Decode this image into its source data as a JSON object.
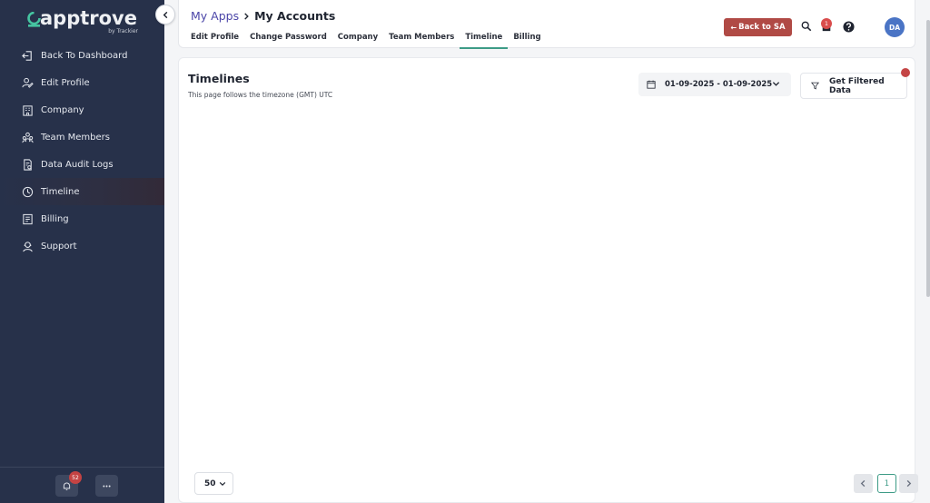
{
  "brand": {
    "name": "apptrove",
    "sub": "by Trackier"
  },
  "sidebar": {
    "items": [
      {
        "label": "Back To Dashboard",
        "icon": "back-dashboard-icon"
      },
      {
        "label": "Edit Profile",
        "icon": "user-edit-icon"
      },
      {
        "label": "Company",
        "icon": "building-icon"
      },
      {
        "label": "Team Members",
        "icon": "team-icon"
      },
      {
        "label": "Data Audit Logs",
        "icon": "audit-log-icon"
      },
      {
        "label": "Timeline",
        "icon": "timeline-icon",
        "active": true
      },
      {
        "label": "Billing",
        "icon": "billing-icon"
      },
      {
        "label": "Support",
        "icon": "support-icon"
      }
    ],
    "notification_count": "52"
  },
  "header": {
    "breadcrumb": {
      "parent": "My Apps",
      "current": "My Accounts"
    },
    "tabs": [
      {
        "label": "Edit Profile"
      },
      {
        "label": "Change Password"
      },
      {
        "label": "Company"
      },
      {
        "label": "Team Members"
      },
      {
        "label": "Timeline",
        "active": true
      },
      {
        "label": "Billing"
      }
    ],
    "back_button": "Back to SA",
    "cart_count": "1",
    "avatar_initials": "DA"
  },
  "main": {
    "title": "Timelines",
    "subtitle": "This page follows the timezone (GMT) UTC",
    "date_range": "01-09-2025 - 01-09-2025",
    "filter_button": "Get Filtered Data",
    "per_page": "50",
    "current_page": "1"
  },
  "colors": {
    "sidebar_bg": "#27314a",
    "accent": "#3d9b86",
    "danger": "#b04a45",
    "breadcrumb_link": "#4b45a8",
    "avatar": "#4a74c5"
  }
}
